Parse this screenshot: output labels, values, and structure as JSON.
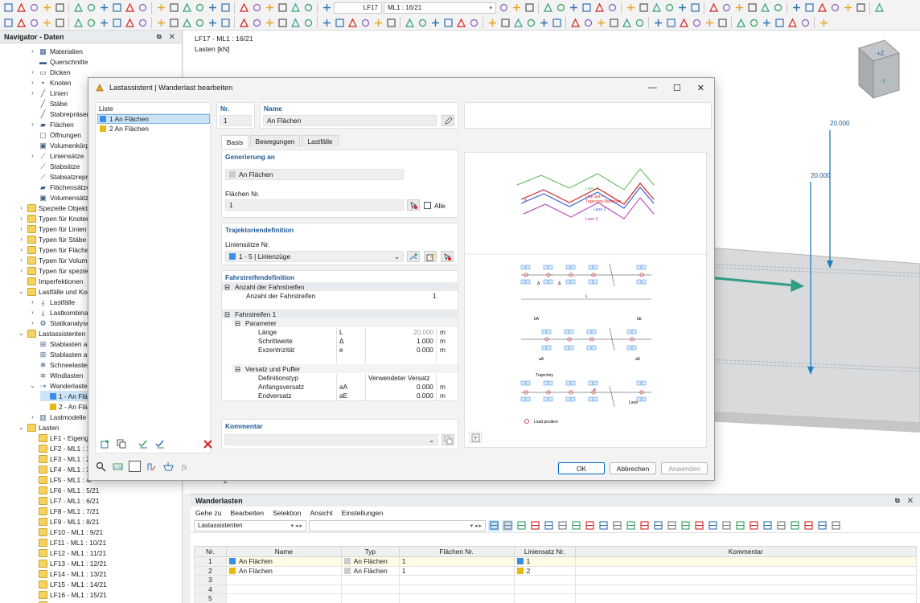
{
  "toolbar": {
    "case_combo": "LF17",
    "model_combo": "ML1 : 16/21"
  },
  "navigator": {
    "title": "Navigator - Daten",
    "items": [
      {
        "label": "Materialien",
        "icon": "material"
      },
      {
        "label": "Querschnitte",
        "icon": "section"
      },
      {
        "label": "Dicken",
        "icon": "thickness"
      },
      {
        "label": "Knoten",
        "icon": "node"
      },
      {
        "label": "Linien",
        "icon": "line"
      },
      {
        "label": "Stäbe",
        "icon": "member"
      },
      {
        "label": "Stabrepräsen",
        "icon": "member-rep"
      },
      {
        "label": "Flächen",
        "icon": "surface"
      },
      {
        "label": "Öffnungen",
        "icon": "opening"
      },
      {
        "label": "Volumenkörp",
        "icon": "solid"
      },
      {
        "label": "Liniensätze",
        "icon": "lineset"
      },
      {
        "label": "Stabsätze",
        "icon": "memberset"
      },
      {
        "label": "Stabsatzreprä",
        "icon": "memberset-rep"
      },
      {
        "label": "Flächensätze",
        "icon": "surfaceset"
      },
      {
        "label": "Volumensätze",
        "icon": "solidset"
      },
      {
        "label": "Spezielle Objekte",
        "icon": "folder"
      },
      {
        "label": "Typen für Knoten",
        "icon": "folder"
      },
      {
        "label": "Typen für Linien",
        "icon": "folder"
      },
      {
        "label": "Typen für Stäbe",
        "icon": "folder"
      },
      {
        "label": "Typen für Flächen",
        "icon": "folder"
      },
      {
        "label": "Typen für Volume",
        "icon": "folder"
      },
      {
        "label": "Typen für speziell",
        "icon": "folder"
      },
      {
        "label": "Imperfektionen",
        "icon": "folder"
      },
      {
        "label": "Lastfälle und Kom",
        "icon": "folder"
      },
      {
        "label": "Lastfälle",
        "icon": "loadcase"
      },
      {
        "label": "Lastkombinat",
        "icon": "loadcombo"
      },
      {
        "label": "Statikanalyse-",
        "icon": "analysis"
      },
      {
        "label": "Lastassistenten",
        "icon": "folder"
      },
      {
        "label": "Stablasten au",
        "icon": "wizard"
      },
      {
        "label": "Stablasten au",
        "icon": "wizard"
      },
      {
        "label": "Schneelasten",
        "icon": "snow"
      },
      {
        "label": "Windlasten",
        "icon": "wind"
      },
      {
        "label": "Wanderlasten",
        "icon": "moving"
      },
      {
        "label": "1 - An Fläc",
        "icon": "swatch-blue"
      },
      {
        "label": "2 - An Fläc",
        "icon": "swatch-yellow"
      },
      {
        "label": "Lastmodelle",
        "icon": "loadmodel"
      },
      {
        "label": "Lasten",
        "icon": "folder"
      },
      {
        "label": "LF1 - Eigenge",
        "icon": "folder"
      },
      {
        "label": "LF2 - ML1 : 1/2",
        "icon": "folder"
      },
      {
        "label": "LF3 - ML1 : 2/2",
        "icon": "folder"
      },
      {
        "label": "LF4 - ML1 : 3/",
        "icon": "folder"
      },
      {
        "label": "LF5 - ML1 : 4/",
        "icon": "folder"
      },
      {
        "label": "LF6 - ML1 : 5/21",
        "icon": "folder"
      },
      {
        "label": "LF7 - ML1 : 6/21",
        "icon": "folder"
      },
      {
        "label": "LF8 - ML1 : 7/21",
        "icon": "folder"
      },
      {
        "label": "LF9 - ML1 : 8/21",
        "icon": "folder"
      },
      {
        "label": "LF10 - ML1 : 9/21",
        "icon": "folder"
      },
      {
        "label": "LF11 - ML1 : 10/21",
        "icon": "folder"
      },
      {
        "label": "LF12 - ML1 : 11/21",
        "icon": "folder"
      },
      {
        "label": "LF13 - ML1 : 12/21",
        "icon": "folder"
      },
      {
        "label": "LF14 - ML1 : 13/21",
        "icon": "folder"
      },
      {
        "label": "LF15 - ML1 : 14/21",
        "icon": "folder"
      },
      {
        "label": "LF16 - ML1 : 15/21",
        "icon": "folder"
      },
      {
        "label": "LF17 - ML1 : 16/21",
        "icon": "folder"
      }
    ]
  },
  "viewport": {
    "case_line": "LF17 - ML1 : 16/21",
    "unit_line": "Lasten [kN]",
    "load_value_1": "20.000",
    "load_value_2": "20.000",
    "cube_label_z": "+Z",
    "cube_label_y": "-Y",
    "axis_z": "Z"
  },
  "dialog": {
    "title": "Lastassistent | Wanderlast bearbeiten",
    "list_header": "Liste",
    "list": [
      {
        "label": "1  An Flächen",
        "color": "#3a8ee6"
      },
      {
        "label": "2  An Flächen",
        "color": "#e8b90f"
      }
    ],
    "nr_label": "Nr.",
    "nr_value": "1",
    "name_label": "Name",
    "name_value": "An Flächen",
    "tabs": [
      "Basis",
      "Bewegungen",
      "Lastfälle"
    ],
    "generierung": {
      "title": "Generierung an",
      "value": "An Flächen",
      "flaechen_label": "Flächen Nr.",
      "flaechen_value": "1",
      "alle_label": "Alle"
    },
    "trajektorie": {
      "title": "Trajektoriendefinition",
      "label": "Liniensätze Nr.",
      "value": "1 - 5 | Linienzüge"
    },
    "fahrstreifen": {
      "title": "Fahrstreifendefinition",
      "anzahl_group": "Anzahl der Fahrstreifen",
      "anzahl_label": "Anzahl der Fahrstreifen",
      "anzahl_value": "1",
      "fs1_group": "Fahrstreifen 1",
      "parameter_group": "Parameter",
      "laenge_label": "Länge",
      "laenge_sym": "L",
      "laenge_value": "20.000",
      "laenge_unit": "m",
      "schritt_label": "Schrittweite",
      "schritt_sym": "Δ",
      "schritt_value": "1.000",
      "schritt_unit": "m",
      "exz_label": "Exzentrizität",
      "exz_sym": "e",
      "exz_value": "0.000",
      "exz_unit": "m",
      "versatz_group": "Versatz und Puffer",
      "deftyp_label": "Definitionstyp",
      "deftyp_value": "Verwendeter Versatz",
      "anfang_label": "Anfangsversatz",
      "anfang_sym": "aA",
      "anfang_value": "0.000",
      "anfang_unit": "m",
      "end_label": "Endversatz",
      "end_sym": "aE",
      "end_value": "0.000",
      "end_unit": "m"
    },
    "kommentar_label": "Kommentar",
    "diagram1": {
      "lane1": "Lane 1",
      "lineset": "Line Set =",
      "trajdef": "Trajectory Definition",
      "lane2": "Lane 2",
      "lane3": "Lane 3",
      "e": "e"
    },
    "diagram2": {
      "delta": "Δ",
      "L": "L",
      "bA": "bA",
      "bE": "bE",
      "aA": "aA",
      "aE": "aE",
      "trajectory": "Trajectory",
      "e": "e",
      "lane": "Lane",
      "load_position": "Load position"
    },
    "ok_label": "OK",
    "cancel_label": "Abbrechen",
    "apply_label": "Anwenden"
  },
  "bottom": {
    "title": "Wanderlasten",
    "menu": [
      "Gehe zu",
      "Bearbeiten",
      "Selektion",
      "Ansicht",
      "Einstellungen"
    ],
    "combo": "Lastassistenten",
    "columns": [
      "Nr.",
      "Name",
      "Typ",
      "Flächen Nr.",
      "Liniensatz Nr.",
      "Kommentar"
    ],
    "rows": [
      {
        "nr": "1",
        "name": "An Flächen",
        "typ": "An Flächen",
        "flaechen": "1",
        "linie": "1",
        "kommentar": "",
        "color_name": "#3a8ee6",
        "color_line": "#3a8ee6"
      },
      {
        "nr": "2",
        "name": "An Flächen",
        "typ": "An Flächen",
        "flaechen": "1",
        "linie": "2",
        "kommentar": "",
        "color_name": "#e8b90f",
        "color_line": "#e8b90f"
      },
      {
        "nr": "3",
        "name": "",
        "typ": "",
        "flaechen": "",
        "linie": "",
        "kommentar": ""
      },
      {
        "nr": "4",
        "name": "",
        "typ": "",
        "flaechen": "",
        "linie": "",
        "kommentar": ""
      },
      {
        "nr": "5",
        "name": "",
        "typ": "",
        "flaechen": "",
        "linie": "",
        "kommentar": ""
      }
    ]
  },
  "colors": {
    "accent": "#0067c0",
    "label_blue": "#1f5a94",
    "arrow_teal": "#2e9e86",
    "load_arrow": "#1f7fc0"
  }
}
